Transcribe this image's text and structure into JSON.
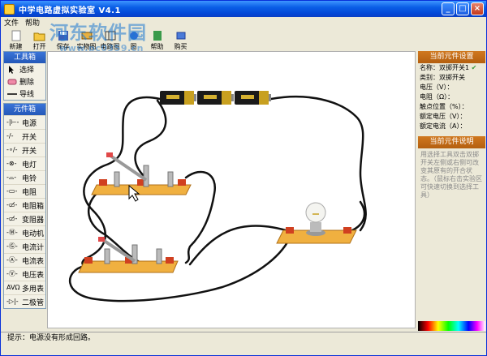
{
  "window": {
    "title": "中学电路虚拟实验室 V4.1",
    "min_label": "_",
    "max_label": "□",
    "close_label": "×"
  },
  "menu": [
    "文件",
    "帮助"
  ],
  "toolbar": [
    "新建",
    "打开",
    "保存",
    "实物图",
    "电路图",
    "图",
    "帮助",
    "购买"
  ],
  "watermark": {
    "text": "河东软件园",
    "url": "www.pc0359.cn"
  },
  "toolbox": {
    "title": "工具箱",
    "items": [
      {
        "label": "选择",
        "icon": "arrow-cursor-icon"
      },
      {
        "label": "删除",
        "icon": "eraser-icon"
      },
      {
        "label": "导线",
        "icon": "wire-icon"
      }
    ]
  },
  "components": {
    "title": "元件箱",
    "items": [
      {
        "label": "电源",
        "symbol": "-|⊢-"
      },
      {
        "label": "开关",
        "symbol": "-∕-"
      },
      {
        "label": "开关",
        "symbol": "-∘∕-"
      },
      {
        "label": "电灯",
        "symbol": "-⊗-"
      },
      {
        "label": "电铃",
        "symbol": "-⌓-"
      },
      {
        "label": "电阻",
        "symbol": "-▭-"
      },
      {
        "label": "电阻箱",
        "symbol": "-▭̸-"
      },
      {
        "label": "变阻器",
        "symbol": "-▭̸-"
      },
      {
        "label": "电动机",
        "symbol": "-Ⓜ-"
      },
      {
        "label": "电流计",
        "symbol": "-Ⓖ-"
      },
      {
        "label": "电流表",
        "symbol": "-Ⓐ-"
      },
      {
        "label": "电压表",
        "symbol": "-Ⓥ-"
      },
      {
        "label": "多用表",
        "symbol": "AVΩ"
      },
      {
        "label": "二极管",
        "symbol": "-▷|-"
      }
    ]
  },
  "properties": {
    "title": "当前元件设置",
    "rows": [
      "名称：双掷开关1",
      "类别：双掷开关",
      "电压（V）：",
      "电阻（Ω）：",
      "触点位置（%）：",
      "额定电压（V）：",
      "额定电流（A）："
    ],
    "check": "✔"
  },
  "description": {
    "title": "当前元件说明",
    "text": "用选择工具双击双掷开关左侧或右侧可改变其原有的开合状态。（鼠标右击实验区可快速切换到选择工具）"
  },
  "status": "提示：电源没有形成回路。",
  "colors": {
    "title_bar": "#0a5ee6",
    "panel_head": "#2458b8",
    "right_head": "#c26a16",
    "wire": "#111111",
    "board": "#f0b040"
  }
}
